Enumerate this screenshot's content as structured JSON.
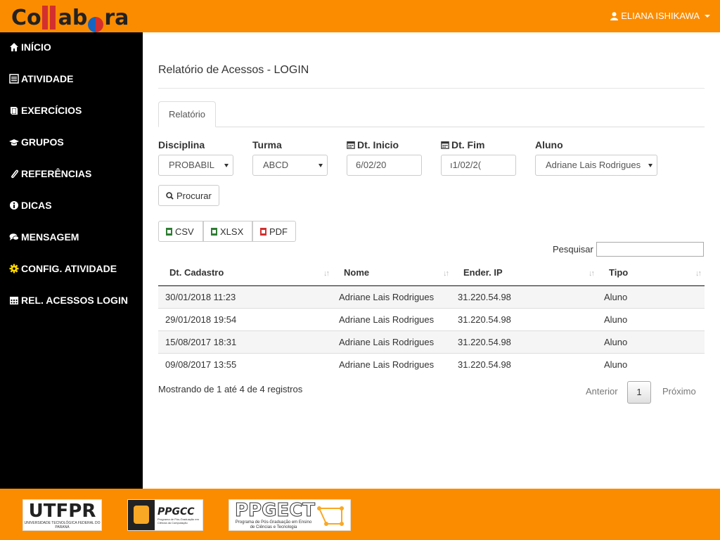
{
  "app": {
    "logo_text_1": "Co",
    "logo_text_2": "ab",
    "logo_text_3": "ra",
    "user_name": "ELIANA ISHIKAWA",
    "accent_color": "#fb8c00"
  },
  "sidebar": {
    "items": [
      {
        "label": "INÍCIO",
        "icon": "home-icon"
      },
      {
        "label": "ATIVIDADE",
        "icon": "list-icon"
      },
      {
        "label": "EXERCÍCIOS",
        "icon": "book-icon"
      },
      {
        "label": "GRUPOS",
        "icon": "graduation-cap-icon"
      },
      {
        "label": "REFERÊNCIAS",
        "icon": "paperclip-icon"
      },
      {
        "label": "DICAS",
        "icon": "info-icon"
      },
      {
        "label": "MENSAGEM",
        "icon": "comments-icon"
      },
      {
        "label": "CONFIG. ATIVIDADE",
        "icon": "gear-icon"
      },
      {
        "label": "REL. ACESSOS LOGIN",
        "icon": "calendar-icon"
      }
    ]
  },
  "main": {
    "title": "Relatório de Acessos - LOGIN",
    "tab": "Relatório",
    "filters": {
      "disciplina_label": "Disciplina",
      "disciplina_value": "PROBABIL",
      "turma_label": "Turma",
      "turma_value": "ABCD",
      "dt_inicio_label": "Dt. Inicio",
      "dt_inicio_value": "6/02/20",
      "dt_fim_label": "Dt. Fim",
      "dt_fim_value": "ı1/02/2(",
      "aluno_label": "Aluno",
      "aluno_value": "Adriane Lais Rodrigues"
    },
    "search_button": "Procurar",
    "export": {
      "csv": "CSV",
      "xlsx": "XLSX",
      "pdf": "PDF"
    },
    "table_search_label": "Pesquisar",
    "table": {
      "headers": [
        "Dt. Cadastro",
        "Nome",
        "Ender. IP",
        "Tipo"
      ],
      "rows": [
        [
          "30/01/2018 11:23",
          "Adriane Lais Rodrigues",
          "31.220.54.98",
          "Aluno"
        ],
        [
          "29/01/2018 19:54",
          "Adriane Lais Rodrigues",
          "31.220.54.98",
          "Aluno"
        ],
        [
          "15/08/2017 18:31",
          "Adriane Lais Rodrigues",
          "31.220.54.98",
          "Aluno"
        ],
        [
          "09/08/2017 13:55",
          "Adriane Lais Rodrigues",
          "31.220.54.98",
          "Aluno"
        ]
      ]
    },
    "info": "Mostrando de 1 até 4 de 4 registros",
    "pagination": {
      "prev": "Anterior",
      "current": "1",
      "next": "Próximo"
    }
  },
  "footer": {
    "logos": {
      "utfpr": "UTFPR",
      "utfpr_sub": "UNIVERSIDADE TECNOLÓGICA FEDERAL DO PARANÁ",
      "ppgcc": "PPGCC",
      "ppgcc_sub": "Programa de Pós-Graduação em Ciência da Computação",
      "ppgect": "PPGECT",
      "ppgect_sub": "Programa de Pós-Graduação em Ensino de Ciências e Tecnologia"
    }
  }
}
